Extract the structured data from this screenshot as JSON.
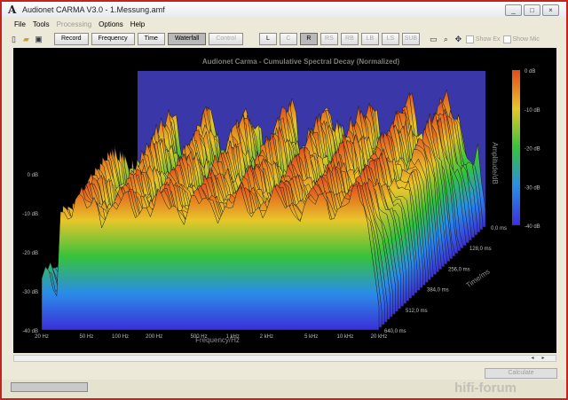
{
  "window": {
    "title": "Audionet CARMA V3.0 - 1.Messung.amf",
    "app_icon": "A",
    "controls": [
      "_",
      "□",
      "×"
    ]
  },
  "menu": [
    {
      "label": "File",
      "enabled": true
    },
    {
      "label": "Tools",
      "enabled": true
    },
    {
      "label": "Processing",
      "enabled": false
    },
    {
      "label": "Options",
      "enabled": true
    },
    {
      "label": "Help",
      "enabled": true
    }
  ],
  "toolbar": {
    "icons": [
      "new-file-icon",
      "open-folder-icon",
      "save-disk-icon"
    ],
    "views": [
      {
        "label": "Record",
        "active": false,
        "enabled": true
      },
      {
        "label": "Frequency",
        "active": false,
        "enabled": true
      },
      {
        "label": "Time",
        "active": false,
        "enabled": true
      },
      {
        "label": "Waterfall",
        "active": true,
        "enabled": true
      },
      {
        "label": "Control",
        "active": false,
        "enabled": false
      }
    ],
    "channels": [
      {
        "label": "L",
        "active": false,
        "enabled": true
      },
      {
        "label": "C",
        "active": false,
        "enabled": true
      },
      {
        "label": "R",
        "active": true,
        "enabled": true
      },
      {
        "label": "RS",
        "active": false,
        "enabled": false
      },
      {
        "label": "RB",
        "active": false,
        "enabled": false
      },
      {
        "label": "LB",
        "active": false,
        "enabled": false
      },
      {
        "label": "LS",
        "active": false,
        "enabled": false
      },
      {
        "label": "SUB",
        "active": false,
        "enabled": false
      }
    ],
    "tool_icons": [
      "window-icon",
      "zoom-icon",
      "move-icon"
    ],
    "checks": [
      {
        "label": "Show Ex",
        "checked": false
      },
      {
        "label": "Show Mic",
        "checked": false
      }
    ]
  },
  "chart_data": {
    "type": "waterfall",
    "title": "Audionet Carma - Cumulative Spectral Decay (Normalized)",
    "xlabel": "Frequency/Hz",
    "ylabel_time": "Time/ms",
    "zlabel": "Amplitude/dB",
    "x_ticks": [
      "20 Hz",
      "50 Hz",
      "100 Hz",
      "200 Hz",
      "500 Hz",
      "1 kHz",
      "2 kHz",
      "5 kHz",
      "10 kHz",
      "20 kHz"
    ],
    "x_range_hz": [
      20,
      20000
    ],
    "time_ticks": [
      "0,0 ms",
      "128,0 ms",
      "256,0 ms",
      "384,0 ms",
      "512,0 ms",
      "640,0 ms"
    ],
    "time_range_ms": [
      0,
      640
    ],
    "z_ticks": [
      "0 dB",
      "-10 dB",
      "-20 dB",
      "-30 dB",
      "-40 dB"
    ],
    "z_range_db": [
      -40,
      0
    ],
    "colorbar_ticks": [
      "0 dB",
      "-10 dB",
      "-20 dB",
      "-30 dB",
      "-40 dB"
    ],
    "colorbar_colors": [
      "#e24a1c",
      "#e8c62a",
      "#36c23c",
      "#2a8ce8",
      "#3b2fd8"
    ],
    "background": "#000000",
    "back_wall_color": "#3a37a8",
    "slice_count": 40
  },
  "buttons": {
    "calculate": "Calculate"
  },
  "watermark": "hifi-forum"
}
